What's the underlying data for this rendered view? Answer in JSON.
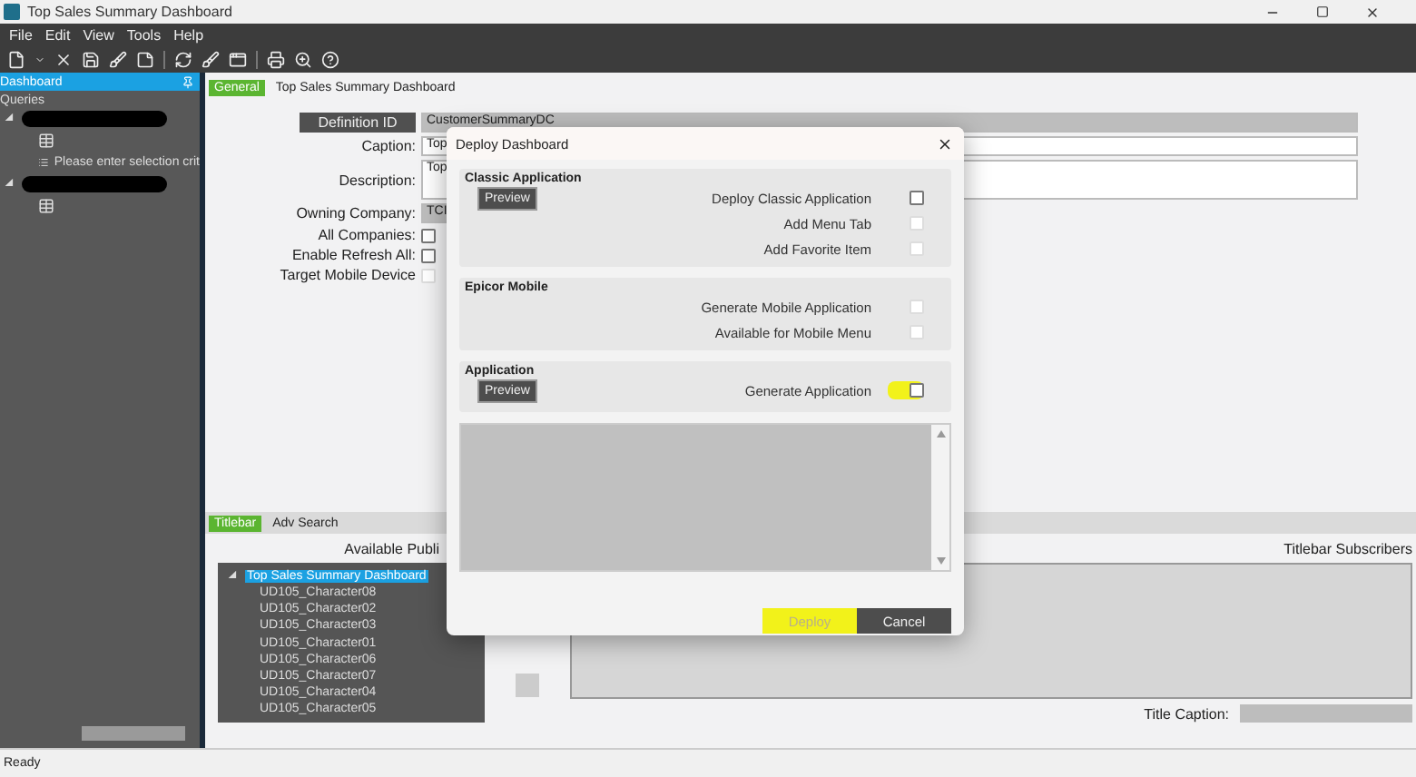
{
  "window": {
    "title": "Top Sales Summary Dashboard"
  },
  "menu": [
    "File",
    "Edit",
    "View",
    "Tools",
    "Help"
  ],
  "sidebar": {
    "title": "Dashboard",
    "section": "Queries",
    "tree": [
      {
        "kind": "redacted",
        "expanded": true,
        "children": [
          {
            "kind": "table"
          },
          {
            "kind": "list",
            "label": "Please enter selection crit"
          }
        ]
      },
      {
        "kind": "redacted",
        "expanded": true,
        "children": [
          {
            "kind": "table"
          }
        ]
      }
    ]
  },
  "tabs": [
    {
      "label": "General",
      "selected": true
    },
    {
      "label": "Top Sales Summary Dashboard",
      "selected": false
    }
  ],
  "form": [
    {
      "kind": "id",
      "label": "Definition ID",
      "value": "CustomerSummaryDC"
    },
    {
      "kind": "text",
      "label": "Caption:",
      "value": "Top"
    },
    {
      "kind": "textarea",
      "label": "Description:",
      "value": "Top"
    },
    {
      "kind": "readonly",
      "label": "Owning Company:",
      "value": "TCI"
    },
    {
      "kind": "checkbox",
      "label": "All Companies:",
      "checked": false,
      "disabled": false
    },
    {
      "kind": "checkbox",
      "label": "Enable Refresh All:",
      "checked": false,
      "disabled": false
    },
    {
      "kind": "checkbox",
      "label": "Target Mobile Device",
      "checked": false,
      "disabled": true
    }
  ],
  "lower_tabs": [
    {
      "label": "Titlebar",
      "selected": true
    },
    {
      "label": "Adv Search",
      "selected": false
    }
  ],
  "publishers": {
    "heading": "Available Publi",
    "root": {
      "label": "Top Sales Summary Dashboard",
      "selected": true,
      "expanded": true
    },
    "items": [
      "UD105_Character08",
      "UD105_Character02",
      "UD105_Character03",
      "UD105_Character01",
      "UD105_Character06",
      "UD105_Character07",
      "UD105_Character04",
      "UD105_Character05"
    ]
  },
  "subscribers": {
    "heading": "Titlebar Subscribers",
    "caption_label": "Title Caption:"
  },
  "dialog": {
    "title": "Deploy Dashboard",
    "sections": [
      {
        "title": "Classic Application",
        "button": "Preview",
        "options": [
          {
            "label": "Deploy Classic Application",
            "checked": false,
            "disabled": false,
            "highlighted": false
          },
          {
            "label": "Add Menu Tab",
            "checked": false,
            "disabled": true,
            "highlighted": false
          },
          {
            "label": "Add Favorite Item",
            "checked": false,
            "disabled": true,
            "highlighted": false
          }
        ]
      },
      {
        "title": "Epicor Mobile",
        "options": [
          {
            "label": "Generate Mobile Application",
            "checked": false,
            "disabled": true,
            "highlighted": false
          },
          {
            "label": "Available for Mobile Menu",
            "checked": false,
            "disabled": true,
            "highlighted": false
          }
        ]
      },
      {
        "title": "Application",
        "button": "Preview",
        "options": [
          {
            "label": "Generate Application",
            "checked": false,
            "disabled": false,
            "highlighted": true
          }
        ]
      }
    ],
    "buttons": [
      {
        "label": "Deploy",
        "disabled": true,
        "highlighted": true
      },
      {
        "label": "Cancel",
        "disabled": false,
        "highlighted": false
      }
    ]
  },
  "status_bar": "Ready"
}
